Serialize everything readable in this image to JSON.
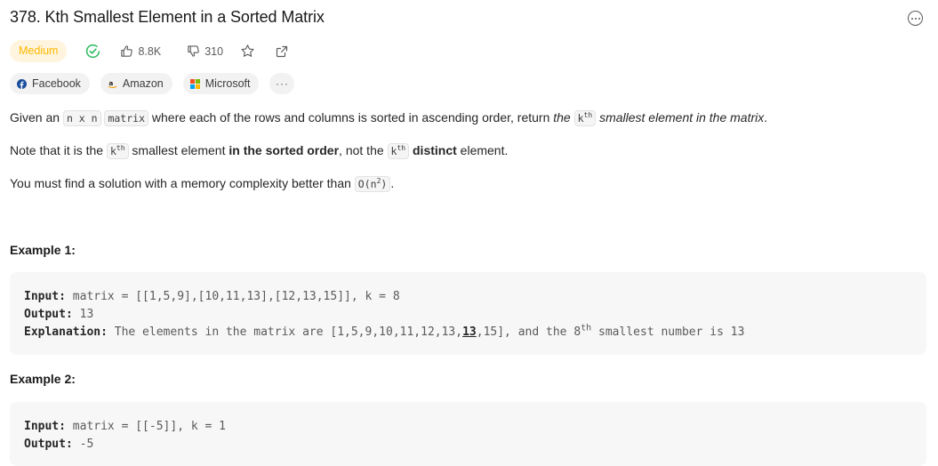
{
  "problem": {
    "title": "378. Kth Smallest Element in a Sorted Matrix",
    "difficulty": "Medium",
    "likes": "8.8K",
    "dislikes": "310",
    "colors": {
      "difficulty_text": "#ffb800",
      "difficulty_bg": "#fff4de",
      "solved_check": "#2cbb5d"
    }
  },
  "tags": [
    {
      "name": "Facebook",
      "icon": "facebook-logo"
    },
    {
      "name": "Amazon",
      "icon": "amazon-logo"
    },
    {
      "name": "Microsoft",
      "icon": "microsoft-logo"
    }
  ],
  "tags_more": "···",
  "description": {
    "p1": {
      "t1": "Given an ",
      "c1": "n x n",
      "t2": " ",
      "c2": "matrix",
      "t3": " where each of the rows and columns is sorted in ascending order, return ",
      "e1": "the",
      "c3": "k",
      "c3sup": "th",
      "e2": " smallest element in the matrix",
      "t4": "."
    },
    "p2": {
      "t1": "Note that it is the ",
      "c1": "k",
      "c1sup": "th",
      "t2": " smallest element ",
      "b1": "in the sorted order",
      "t3": ", not the ",
      "c2": "k",
      "c2sup": "th",
      "b2": " distinct",
      "t4": " element."
    },
    "p3": {
      "t1": "You must find a solution with a memory complexity better than ",
      "c1": "O(n",
      "c1sup": "2",
      "c1end": ")",
      "t2": "."
    }
  },
  "examples": [
    {
      "title": "Example 1:",
      "input_label": "Input:",
      "input": " matrix = [[1,5,9],[10,11,13],[12,13,15]], k = 8",
      "output_label": "Output:",
      "output": " 13",
      "explanation_label": "Explanation:",
      "explanation_pre": " The elements in the matrix are [1,5,9,10,11,12,13,",
      "explanation_hl": "13",
      "explanation_mid": ",15], and the 8",
      "explanation_sup": "th",
      "explanation_post": " smallest number is 13"
    },
    {
      "title": "Example 2:",
      "input_label": "Input:",
      "input": " matrix = [[-5]], k = 1",
      "output_label": "Output:",
      "output": " -5"
    }
  ]
}
